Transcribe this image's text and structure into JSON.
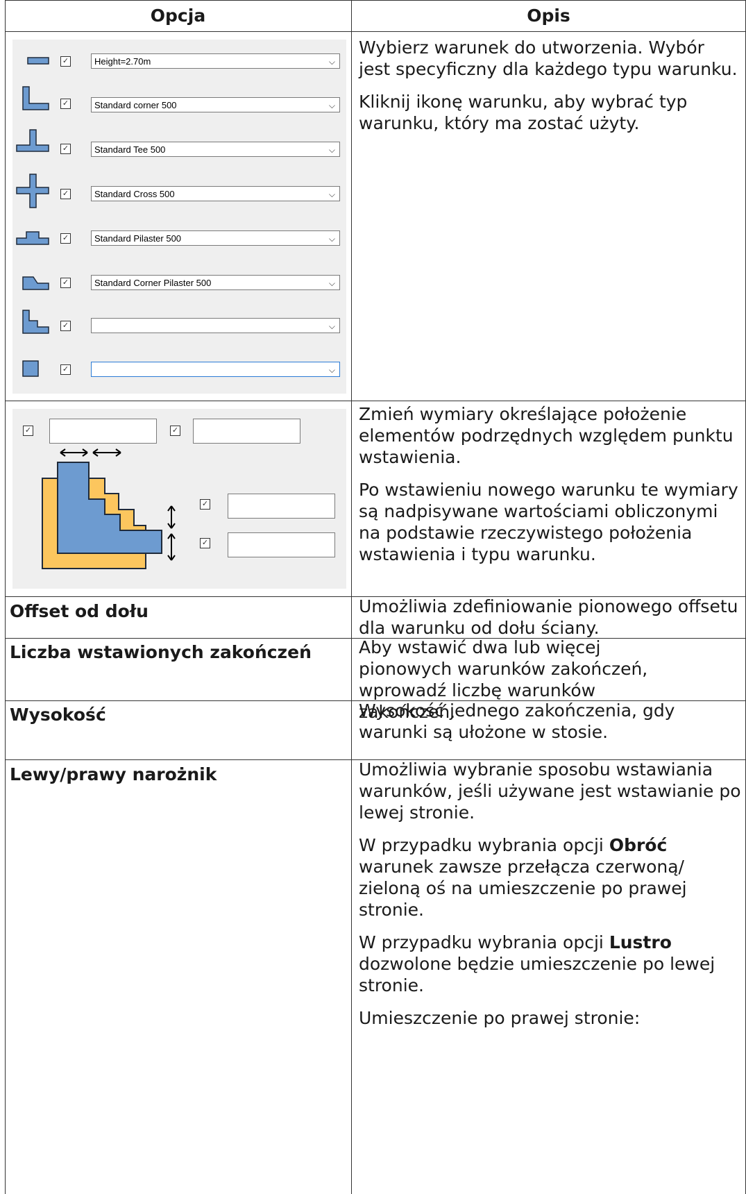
{
  "header": {
    "col1": "Opcja",
    "col2": "Opis"
  },
  "row1": {
    "desc_p1": "Wybierz warunek do utworzenia. Wybór jest specyficzny dla każdego typu warunku.",
    "desc_p2": "Kliknij ikonę warunku, aby wybrać typ warunku, który ma zostać użyty.",
    "combos": [
      "Height=2.70m",
      "Standard corner 500",
      "Standard Tee 500",
      "Standard Cross 500",
      "Standard Pilaster 500",
      "Standard Corner Pilaster 500",
      "",
      ""
    ],
    "icons": [
      "wall-segment-icon",
      "corner-icon",
      "tee-icon",
      "cross-icon",
      "pilaster-icon",
      "corner-pilaster-icon",
      "corner-icon",
      "square-icon"
    ]
  },
  "row2": {
    "desc_p1": "Zmień wymiary określające położenie elementów podrzędnych względem punktu wstawienia.",
    "desc_p2": "Po wstawieniu nowego warunku te wymiary są nadpisywane wartościami obliczonymi na podstawie rzeczywistego położenia wstawienia i typu warunku."
  },
  "row3": {
    "label": "Offset od dołu",
    "desc": "Umożliwia zdefiniowanie pionowego offsetu dla warunku od dołu ściany."
  },
  "row4": {
    "label": "Liczba wstawionych zakończeń",
    "desc": "Aby wstawić dwa lub więcej pionowych warunków zakończeń, wprowadź liczbę warunków zakończeń."
  },
  "row5": {
    "label": "Wysokość",
    "desc": "Wysokość jednego zakończenia, gdy warunki są ułożone w stosie."
  },
  "row6": {
    "label": "Lewy/prawy narożnik",
    "desc_p1": "Umożliwia wybranie sposobu wstawiania warunków, jeśli używane jest wstawianie po lewej stronie.",
    "desc_p2_a": "W przypadku wybrania opcji ",
    "desc_p2_b": "Obróć",
    "desc_p2_c": " warunek zawsze przełącza czerwoną/ zieloną oś na umieszczenie po prawej stronie.",
    "desc_p3_a": "W przypadku wybrania opcji ",
    "desc_p3_b": "Lustro",
    "desc_p3_c": " dozwolone będzie umieszczenie po lewej stronie.",
    "desc_p4": "Umieszczenie po prawej stronie:"
  },
  "colors": {
    "blue": "#6d9bd0",
    "orange": "#fcc65e",
    "panel": "#efefef"
  }
}
